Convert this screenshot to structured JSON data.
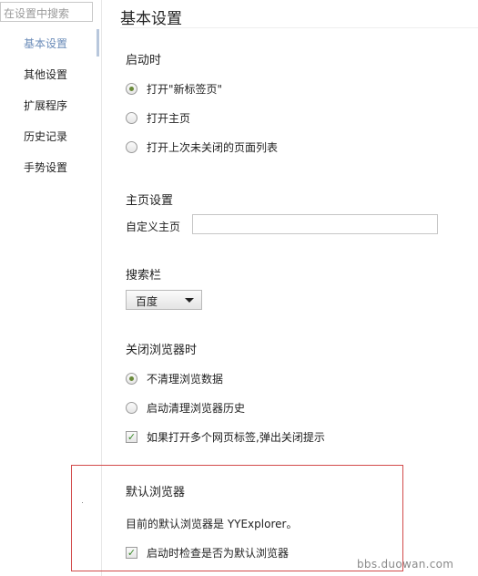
{
  "sidebar": {
    "search_placeholder": "在设置中搜索",
    "items": [
      {
        "label": "基本设置",
        "active": true
      },
      {
        "label": "其他设置"
      },
      {
        "label": "扩展程序"
      },
      {
        "label": "历史记录"
      },
      {
        "label": "手势设置"
      }
    ]
  },
  "main": {
    "title": "基本设置",
    "startup": {
      "title": "启动时",
      "options": [
        {
          "label": "打开\"新标签页\"",
          "selected": true
        },
        {
          "label": "打开主页",
          "selected": false
        },
        {
          "label": "打开上次未关闭的页面列表",
          "selected": false
        }
      ]
    },
    "homepage": {
      "title": "主页设置",
      "custom_label": "自定义主页",
      "value": ""
    },
    "search": {
      "title": "搜索栏",
      "selected": "百度"
    },
    "close": {
      "title": "关闭浏览器时",
      "options": [
        {
          "label": "不清理浏览数据",
          "selected": true
        },
        {
          "label": "启动清理浏览器历史",
          "selected": false
        }
      ],
      "checkbox": {
        "label": "如果打开多个网页标签,弹出关闭提示",
        "checked": true,
        "mark": "✓"
      }
    },
    "default_browser": {
      "title": "默认浏览器",
      "status": "目前的默认浏览器是 YYExplorer。",
      "checkbox": {
        "label": "启动时检查是否为默认浏览器",
        "checked": true,
        "mark": "✓"
      }
    }
  },
  "watermark": "bbs.duowan.com",
  "colors": {
    "active_nav": "#6a8bb8",
    "highlight_border": "#d24a4a",
    "check": "#3b8a2a",
    "radio_dot": "#6a8a3a"
  }
}
